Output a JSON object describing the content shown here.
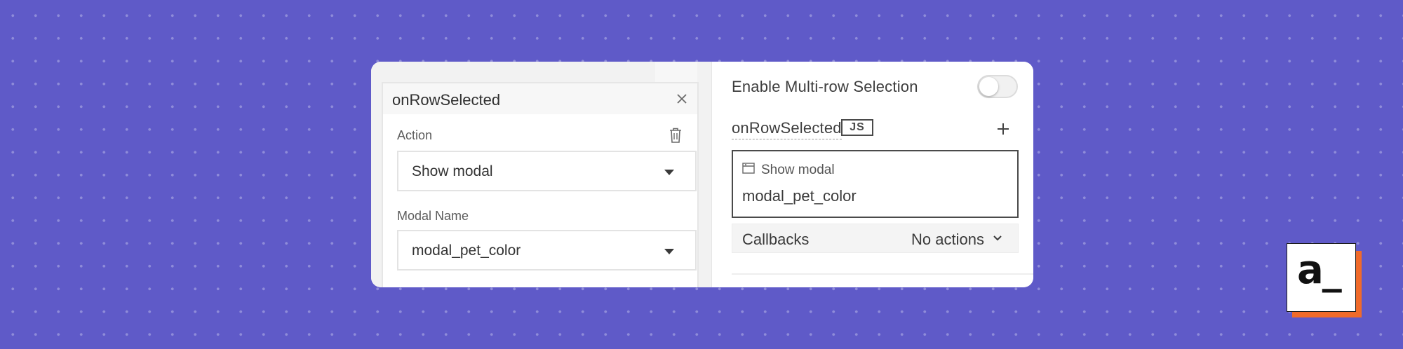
{
  "popup": {
    "title": "onRowSelected",
    "action_label": "Action",
    "action_value": "Show modal",
    "modal_name_label": "Modal Name",
    "modal_name_value": "modal_pet_color"
  },
  "properties": {
    "multi_row_label": "Enable Multi-row Selection",
    "multi_row_enabled": false,
    "event_label": "onRowSelected",
    "js_badge": "JS",
    "action_card": {
      "type": "Show modal",
      "value": "modal_pet_color"
    },
    "callbacks_label": "Callbacks",
    "callbacks_value": "No actions"
  },
  "logo": {
    "text": "a_"
  },
  "colors": {
    "background": "#5f5ac8",
    "logo_accent": "#f06a2a"
  },
  "icons": [
    "close-icon",
    "trash-icon",
    "chevron-down-icon",
    "plus-icon",
    "modal-window-icon"
  ]
}
